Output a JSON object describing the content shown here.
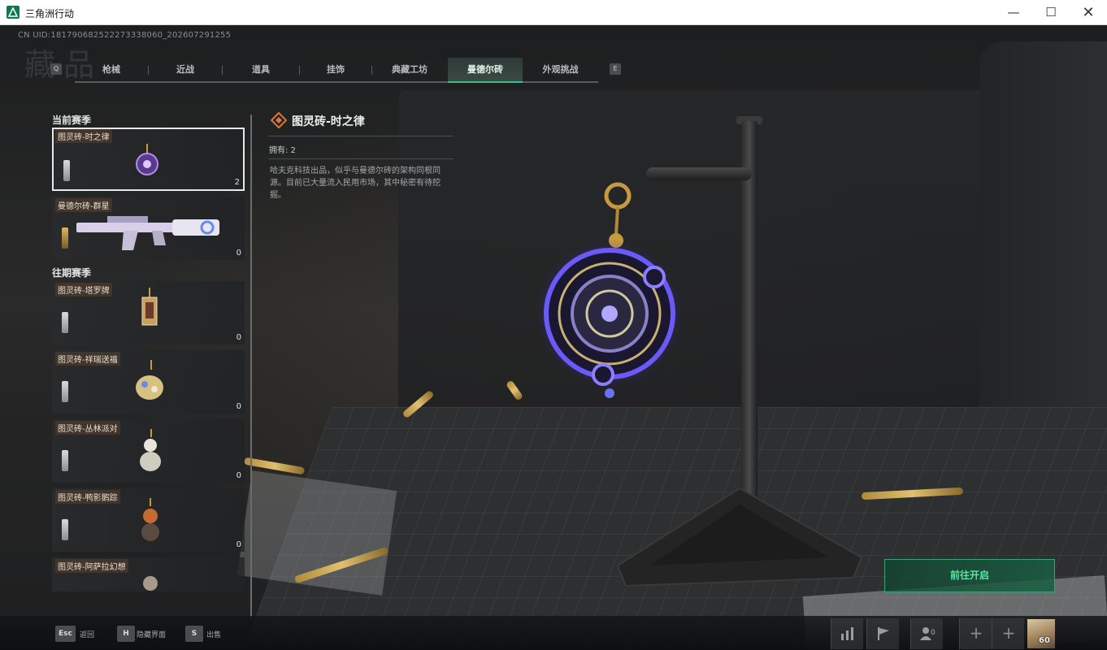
{
  "window": {
    "title": "三角洲行动",
    "minimize_glyph": "—",
    "maximize_glyph": "☐",
    "close_glyph": "✕"
  },
  "header": {
    "uid": "CN UID:181790682522273338060_202607291255",
    "page_title": "藏品",
    "key_prev": "Q",
    "key_next": "E"
  },
  "tabs": [
    {
      "label": "枪械"
    },
    {
      "label": "近战"
    },
    {
      "label": "道具"
    },
    {
      "label": "挂饰"
    },
    {
      "label": "典藏工坊"
    },
    {
      "label": "曼德尔砖"
    },
    {
      "label": "外观挑战"
    }
  ],
  "active_tab": 5,
  "sections": {
    "current": "当前赛季",
    "past": "往期赛季"
  },
  "items": [
    {
      "name": "图灵砖-时之律",
      "count": "2"
    },
    {
      "name": "曼德尔砖-群星",
      "count": "0"
    },
    {
      "name": "图灵砖-塔罗牌",
      "count": "0"
    },
    {
      "name": "图灵砖-祥瑞送福",
      "count": "0"
    },
    {
      "name": "图灵砖-丛林派对",
      "count": "0"
    },
    {
      "name": "图灵砖-鸭影鹅踪",
      "count": "0"
    },
    {
      "name": "图灵砖-阿萨拉幻想",
      "count": ""
    }
  ],
  "detail": {
    "title": "图灵砖-时之律",
    "owned": "拥有: 2",
    "description": "哈夫克科技出品，似乎与曼德尔砖的架构同根同源。目前已大量流入民用市场，其中秘密有待挖掘。"
  },
  "action_button": "前往开启",
  "hints": [
    {
      "key": "Esc",
      "label": "返回"
    },
    {
      "key": "H",
      "label": "隐藏界面"
    },
    {
      "key": "S",
      "label": "出售"
    }
  ],
  "bottom_right": {
    "friends_count": "0",
    "plus_glyph": "+",
    "level": "60"
  },
  "colors": {
    "accent": "#38c089",
    "button_text": "#5de3a5"
  },
  "icons": [
    "app-logo-icon",
    "stats-icon",
    "flag-icon",
    "friends-icon",
    "add-icon",
    "rarity-diamond-icon"
  ]
}
